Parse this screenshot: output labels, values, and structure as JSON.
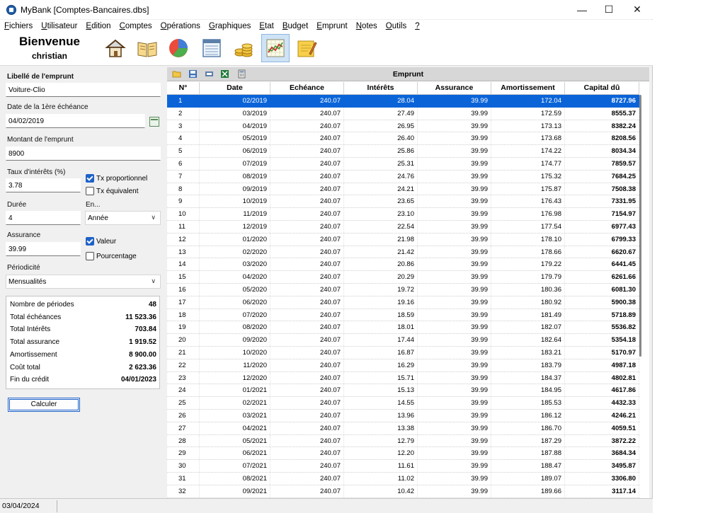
{
  "window": {
    "title": "MyBank [Comptes-Bancaires.dbs]"
  },
  "menu": [
    "Fichiers",
    "Utilisateur",
    "Edition",
    "Comptes",
    "Opérations",
    "Graphiques",
    "Etat",
    "Budget",
    "Emprunt",
    "Notes",
    "Outils",
    "?"
  ],
  "welcome": {
    "title": "Bienvenue",
    "user": "christian"
  },
  "toolbar": {
    "icons": [
      "home-icon",
      "book-icon",
      "pie-chart-icon",
      "register-icon",
      "coins-icon",
      "line-chart-icon",
      "notes-icon"
    ],
    "active": "line-chart-icon"
  },
  "form": {
    "libelle_label": "Libellé de l'emprunt",
    "libelle_value": "Voiture-Clio",
    "date_label": "Date de la 1ère échéance",
    "date_value": "04/02/2019",
    "montant_label": "Montant de l'emprunt",
    "montant_value": "8900",
    "taux_label": "Taux d'intérêts (%)",
    "taux_value": "3.78",
    "tx_prop_label": "Tx proportionnel",
    "tx_prop_checked": true,
    "tx_eq_label": "Tx équivalent",
    "tx_eq_checked": false,
    "duree_label": "Durée",
    "duree_value": "4",
    "en_label": "En...",
    "en_value": "Année",
    "assurance_label": "Assurance",
    "assurance_value": "39.99",
    "valeur_label": "Valeur",
    "valeur_checked": true,
    "pourcentage_label": "Pourcentage",
    "pourcentage_checked": false,
    "periodicite_label": "Périodicité",
    "periodicite_value": "Mensualités"
  },
  "summary": [
    {
      "label": "Nombre de périodes",
      "value": "48"
    },
    {
      "label": "Total échéances",
      "value": "11 523.36"
    },
    {
      "label": "Total Intérêts",
      "value": "703.84"
    },
    {
      "label": "Total assurance",
      "value": "1 919.52"
    },
    {
      "label": "Amortissement",
      "value": "8 900.00"
    },
    {
      "label": "Coût total",
      "value": "2 623.36"
    },
    {
      "label": "Fin du crédit",
      "value": "04/01/2023"
    }
  ],
  "calc_button": "Calculer",
  "grid": {
    "title": "Emprunt",
    "header_icons": [
      "open-folder-icon",
      "save-icon",
      "print-preview-icon",
      "excel-export-icon",
      "calculator-icon"
    ],
    "columns": [
      "N°",
      "Date",
      "Echéance",
      "Intérêts",
      "Assurance",
      "Amortissement",
      "Capital dû"
    ],
    "selected_row": 0,
    "rows": [
      [
        "1",
        "02/2019",
        "240.07",
        "28.04",
        "39.99",
        "172.04",
        "8727.96"
      ],
      [
        "2",
        "03/2019",
        "240.07",
        "27.49",
        "39.99",
        "172.59",
        "8555.37"
      ],
      [
        "3",
        "04/2019",
        "240.07",
        "26.95",
        "39.99",
        "173.13",
        "8382.24"
      ],
      [
        "4",
        "05/2019",
        "240.07",
        "26.40",
        "39.99",
        "173.68",
        "8208.56"
      ],
      [
        "5",
        "06/2019",
        "240.07",
        "25.86",
        "39.99",
        "174.22",
        "8034.34"
      ],
      [
        "6",
        "07/2019",
        "240.07",
        "25.31",
        "39.99",
        "174.77",
        "7859.57"
      ],
      [
        "7",
        "08/2019",
        "240.07",
        "24.76",
        "39.99",
        "175.32",
        "7684.25"
      ],
      [
        "8",
        "09/2019",
        "240.07",
        "24.21",
        "39.99",
        "175.87",
        "7508.38"
      ],
      [
        "9",
        "10/2019",
        "240.07",
        "23.65",
        "39.99",
        "176.43",
        "7331.95"
      ],
      [
        "10",
        "11/2019",
        "240.07",
        "23.10",
        "39.99",
        "176.98",
        "7154.97"
      ],
      [
        "11",
        "12/2019",
        "240.07",
        "22.54",
        "39.99",
        "177.54",
        "6977.43"
      ],
      [
        "12",
        "01/2020",
        "240.07",
        "21.98",
        "39.99",
        "178.10",
        "6799.33"
      ],
      [
        "13",
        "02/2020",
        "240.07",
        "21.42",
        "39.99",
        "178.66",
        "6620.67"
      ],
      [
        "14",
        "03/2020",
        "240.07",
        "20.86",
        "39.99",
        "179.22",
        "6441.45"
      ],
      [
        "15",
        "04/2020",
        "240.07",
        "20.29",
        "39.99",
        "179.79",
        "6261.66"
      ],
      [
        "16",
        "05/2020",
        "240.07",
        "19.72",
        "39.99",
        "180.36",
        "6081.30"
      ],
      [
        "17",
        "06/2020",
        "240.07",
        "19.16",
        "39.99",
        "180.92",
        "5900.38"
      ],
      [
        "18",
        "07/2020",
        "240.07",
        "18.59",
        "39.99",
        "181.49",
        "5718.89"
      ],
      [
        "19",
        "08/2020",
        "240.07",
        "18.01",
        "39.99",
        "182.07",
        "5536.82"
      ],
      [
        "20",
        "09/2020",
        "240.07",
        "17.44",
        "39.99",
        "182.64",
        "5354.18"
      ],
      [
        "21",
        "10/2020",
        "240.07",
        "16.87",
        "39.99",
        "183.21",
        "5170.97"
      ],
      [
        "22",
        "11/2020",
        "240.07",
        "16.29",
        "39.99",
        "183.79",
        "4987.18"
      ],
      [
        "23",
        "12/2020",
        "240.07",
        "15.71",
        "39.99",
        "184.37",
        "4802.81"
      ],
      [
        "24",
        "01/2021",
        "240.07",
        "15.13",
        "39.99",
        "184.95",
        "4617.86"
      ],
      [
        "25",
        "02/2021",
        "240.07",
        "14.55",
        "39.99",
        "185.53",
        "4432.33"
      ],
      [
        "26",
        "03/2021",
        "240.07",
        "13.96",
        "39.99",
        "186.12",
        "4246.21"
      ],
      [
        "27",
        "04/2021",
        "240.07",
        "13.38",
        "39.99",
        "186.70",
        "4059.51"
      ],
      [
        "28",
        "05/2021",
        "240.07",
        "12.79",
        "39.99",
        "187.29",
        "3872.22"
      ],
      [
        "29",
        "06/2021",
        "240.07",
        "12.20",
        "39.99",
        "187.88",
        "3684.34"
      ],
      [
        "30",
        "07/2021",
        "240.07",
        "11.61",
        "39.99",
        "188.47",
        "3495.87"
      ],
      [
        "31",
        "08/2021",
        "240.07",
        "11.02",
        "39.99",
        "189.07",
        "3306.80"
      ],
      [
        "32",
        "09/2021",
        "240.07",
        "10.42",
        "39.99",
        "189.66",
        "3117.14"
      ]
    ]
  },
  "status": {
    "date": "03/04/2024"
  },
  "colors": {
    "selection": "#0a64d8",
    "checkbox": "#1e62c8"
  }
}
